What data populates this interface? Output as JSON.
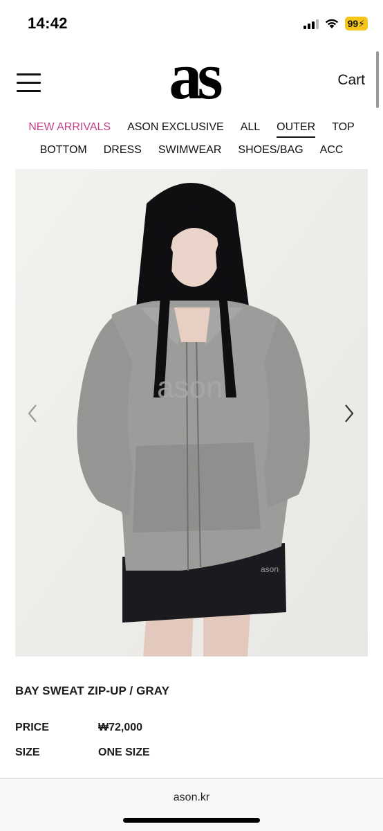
{
  "status_bar": {
    "time": "14:42",
    "battery": "99"
  },
  "header": {
    "logo": "as",
    "cart_label": "Cart"
  },
  "nav": {
    "row1": [
      {
        "label": "NEW ARRIVALS",
        "state": "highlight"
      },
      {
        "label": "ASON EXCLUSIVE",
        "state": ""
      },
      {
        "label": "ALL",
        "state": ""
      },
      {
        "label": "OUTER",
        "state": "active"
      },
      {
        "label": "TOP",
        "state": ""
      }
    ],
    "row2": [
      {
        "label": "BOTTOM"
      },
      {
        "label": "DRESS"
      },
      {
        "label": "SWIMWEAR"
      },
      {
        "label": "SHOES/BAG"
      },
      {
        "label": "ACC"
      }
    ]
  },
  "product": {
    "image_icon": "product-photo-model-in-gray-zip-up",
    "title": "BAY SWEAT ZIP-UP / GRAY",
    "price_label": "PRICE",
    "price_value": "₩72,000",
    "size_label": "SIZE",
    "size_value": "ONE SIZE"
  },
  "browser": {
    "url": "ason.kr"
  },
  "colors": {
    "highlight": "#c2428b",
    "text": "#1a1a1a",
    "battery": "#f5c518"
  }
}
